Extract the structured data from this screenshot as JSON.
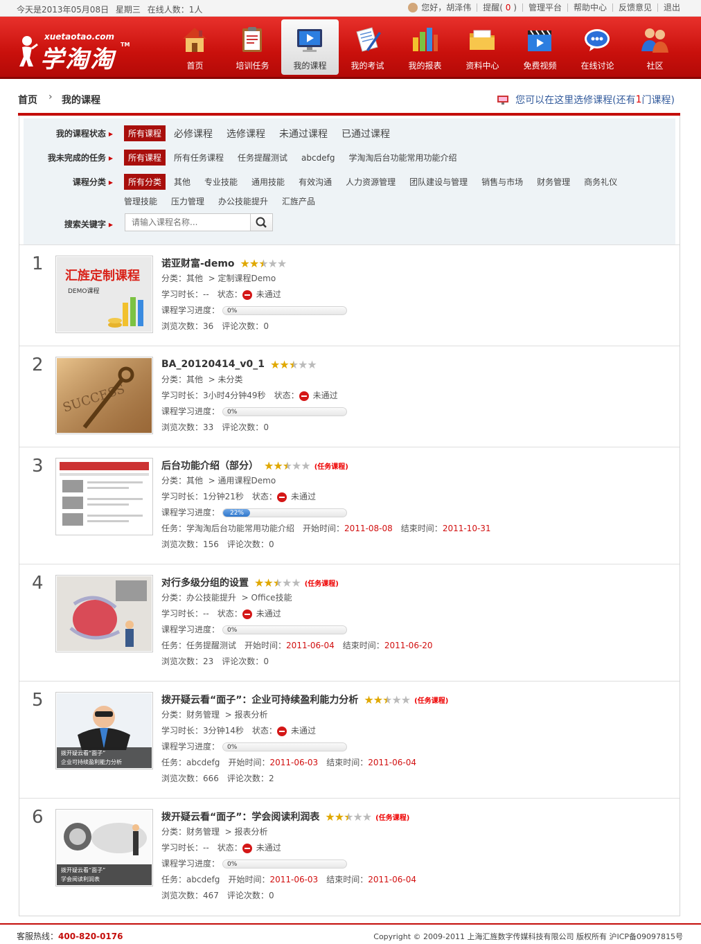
{
  "topbar": {
    "date_text": "今天是2013年05月08日",
    "weekday": "星期三",
    "online": "在线人数：1人",
    "greeting": "您好，胡泽伟",
    "remind_label": "提醒(",
    "remind_count": "0",
    "remind_close": ")",
    "links": [
      "管理平台",
      "帮助中心",
      "反馈意见",
      "退出"
    ]
  },
  "header": {
    "site": "xuetaotao.com",
    "brand": "学淘淘",
    "tm": "TM",
    "nav": [
      {
        "label": "首页",
        "icon": "house-icon"
      },
      {
        "label": "培训任务",
        "icon": "clipboard-icon"
      },
      {
        "label": "我的课程",
        "icon": "monitor-icon"
      },
      {
        "label": "我的考试",
        "icon": "exam-paper-icon"
      },
      {
        "label": "我的报表",
        "icon": "bar-chart-icon"
      },
      {
        "label": "资料中心",
        "icon": "folder-icon"
      },
      {
        "label": "免费视频",
        "icon": "video-clapper-icon"
      },
      {
        "label": "在线讨论",
        "icon": "chat-bubble-icon"
      },
      {
        "label": "社区",
        "icon": "community-icon"
      }
    ]
  },
  "breadcrumb": {
    "home": "首页",
    "current": "我的课程",
    "tip_prefix": "您可以在这里选修课程(还有",
    "tip_count": "1",
    "tip_suffix": "门课程)"
  },
  "filters": {
    "status": {
      "label": "我的课程状态",
      "options": [
        "所有课程",
        "必修课程",
        "选修课程",
        "未通过课程",
        "已通过课程"
      ]
    },
    "tasks": {
      "label": "我未完成的任务",
      "options": [
        "所有课程",
        "所有任务课程",
        "任务提醒测试",
        "abcdefg",
        "学淘淘后台功能常用功能介绍"
      ]
    },
    "category": {
      "label": "课程分类",
      "options_row1": [
        "所有分类",
        "其他",
        "专业技能",
        "通用技能",
        "有效沟通",
        "人力资源管理",
        "团队建设与管理",
        "销售与市场",
        "财务管理",
        "商务礼仪"
      ],
      "options_row2": [
        "管理技能",
        "压力管理",
        "办公技能提升",
        "汇旌产品"
      ]
    },
    "search": {
      "label": "搜索关键字",
      "placeholder": "请输入课程名称..."
    }
  },
  "labels": {
    "category": "分类：",
    "duration": "学习时长：",
    "status": "状态：",
    "progress": "课程学习进度：",
    "task": "任务：",
    "start": "开始时间：",
    "end": "结束时间：",
    "views": "浏览次数：",
    "comments": "评论次数：",
    "task_tag": "(任务课程)"
  },
  "courses": [
    {
      "num": "1",
      "title": "诺亚财富-demo",
      "rating": 2.5,
      "is_task": false,
      "cat1": "其他",
      "cat2": "> 定制课程Demo",
      "duration": "--",
      "status": "未通过",
      "progress": 0,
      "progress_text": "0%",
      "task": "",
      "start": "",
      "end": "",
      "views": "36",
      "comments": "0",
      "thumb_title": "汇旌定制课程",
      "thumb_sub": "DEMO课程"
    },
    {
      "num": "2",
      "title": "BA_20120414_v0_1",
      "rating": 2.5,
      "is_task": false,
      "cat1": "其他",
      "cat2": "> 未分类",
      "duration": "3小时4分钟49秒",
      "status": "未通过",
      "progress": 0,
      "progress_text": "0%",
      "task": "",
      "start": "",
      "end": "",
      "views": "33",
      "comments": "0",
      "thumb_title": "SUCCESS",
      "thumb_sub": ""
    },
    {
      "num": "3",
      "title": "后台功能介绍（部分）",
      "rating": 2.5,
      "is_task": true,
      "cat1": "其他",
      "cat2": "> 通用课程Demo",
      "duration": "1分钟21秒",
      "status": "未通过",
      "progress": 0.22,
      "progress_text": "22%",
      "task": "学淘淘后台功能常用功能介绍",
      "start": "2011-08-08",
      "end": "2011-10-31",
      "views": "156",
      "comments": "0",
      "thumb_title": "",
      "thumb_sub": ""
    },
    {
      "num": "4",
      "title": "对行多级分组的设置",
      "rating": 2.5,
      "is_task": true,
      "cat1": "办公技能提升",
      "cat2": "> Office技能",
      "duration": "--",
      "status": "未通过",
      "progress": 0,
      "progress_text": "0%",
      "task": "任务提醒测试",
      "start": "2011-06-04",
      "end": "2011-06-20",
      "views": "23",
      "comments": "0",
      "thumb_title": "",
      "thumb_sub": ""
    },
    {
      "num": "5",
      "title": "拨开疑云看“面子”：企业可持续盈利能力分析",
      "rating": 2.5,
      "is_task": true,
      "cat1": "财务管理",
      "cat2": "> 报表分析",
      "duration": "3分钟14秒",
      "status": "未通过",
      "progress": 0,
      "progress_text": "0%",
      "task": "abcdefg",
      "start": "2011-06-03",
      "end": "2011-06-04",
      "views": "666",
      "comments": "2",
      "thumb_title": "拨开疑云看“面子”",
      "thumb_sub": "企业可持续盈利能力分析"
    },
    {
      "num": "6",
      "title": "拨开疑云看“面子”：学会阅读利润表",
      "rating": 2.5,
      "is_task": true,
      "cat1": "财务管理",
      "cat2": "> 报表分析",
      "duration": "--",
      "status": "未通过",
      "progress": 0,
      "progress_text": "0%",
      "task": "abcdefg",
      "start": "2011-06-03",
      "end": "2011-06-04",
      "views": "467",
      "comments": "0",
      "thumb_title": "拨开疑云看“面子”",
      "thumb_sub": "学会阅读利润表"
    }
  ],
  "footer": {
    "hotline_label": "客服热线：",
    "hotline": "400-820-0176",
    "copyright": "Copyright © 2009-2011 上海汇旌数字传媒科技有限公司  版权所有  沪ICP备09097815号"
  },
  "colors": {
    "brand_red": "#c40d0a",
    "star": "#e0a800",
    "link_blue": "#335b9c",
    "progress_blue": "#2f78cc"
  }
}
